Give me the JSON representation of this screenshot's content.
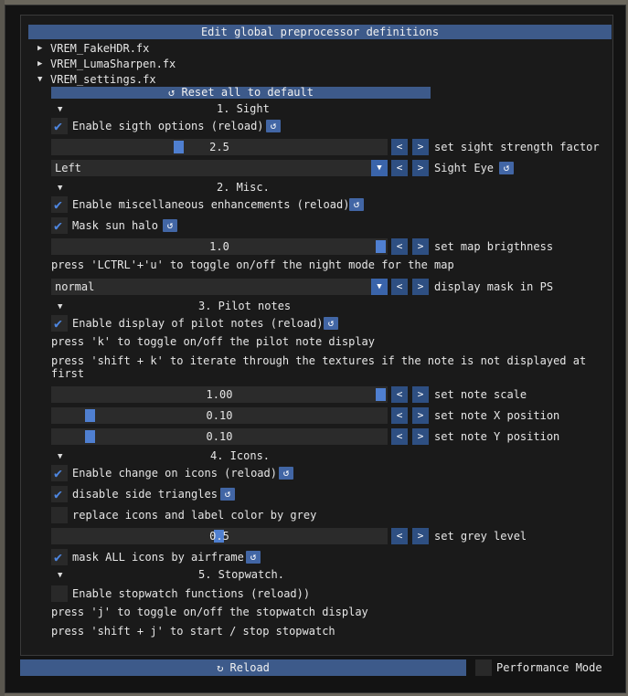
{
  "header": {
    "title": "Edit global preprocessor definitions"
  },
  "tree": [
    {
      "label": "VREM_FakeHDR.fx",
      "expanded": false
    },
    {
      "label": "VREM_LumaSharpen.fx",
      "expanded": false
    },
    {
      "label": "VREM_settings.fx",
      "expanded": true
    }
  ],
  "reset_all": {
    "icon": "↺",
    "label": "Reset all to default"
  },
  "categories": {
    "sight": "1. Sight",
    "misc": "2. Misc.",
    "pilot": "3. Pilot notes",
    "icons": "4. Icons.",
    "stopwatch": "5. Stopwatch."
  },
  "options": {
    "enable_sight": "Enable sigth options (reload)",
    "sight_strength": {
      "value": "2.5",
      "fraction": 0.38,
      "label": "set sight strength factor"
    },
    "sight_eye": {
      "value": "Left",
      "label": "Sight Eye"
    },
    "enable_misc": "Enable miscellaneous enhancements (reload)",
    "mask_sun_halo": "Mask sun halo",
    "map_brightness": {
      "value": "1.0",
      "fraction": 1.0,
      "label": "set map brigthness"
    },
    "night_mode_hint": "press 'LCTRL'+'u' to toggle on/off the night mode for the map",
    "mask_ps": {
      "value": "normal",
      "label": "display mask in PS"
    },
    "enable_pilot": "Enable display of pilot notes (reload)",
    "pilot_hint1": "press 'k' to toggle on/off the pilot note display",
    "pilot_hint2a": "press 'shift + k' to iterate through the textures if the note is not displayed at",
    "pilot_hint2b": "first",
    "note_scale": {
      "value": "1.00",
      "fraction": 1.0,
      "label": "set note scale"
    },
    "note_x": {
      "value": "0.10",
      "fraction": 0.1,
      "label": "set note X position"
    },
    "note_y": {
      "value": "0.10",
      "fraction": 0.1,
      "label": "set note Y position"
    },
    "enable_icons": "Enable change on icons (reload)",
    "disable_triangles": "disable side triangles",
    "replace_grey": "replace icons and label color by grey",
    "grey_level": {
      "value": "0.5",
      "fraction": 0.5,
      "label": "set grey level"
    },
    "mask_airframe": "mask ALL icons by airframe",
    "enable_stopwatch": "Enable stopwatch functions (reload))",
    "sw_hint1": "press 'j' to toggle on/off the stopwatch display",
    "sw_hint2": "press 'shift + j' to start / stop stopwatch"
  },
  "checked": {
    "enable_sight": true,
    "enable_misc": true,
    "mask_sun_halo": true,
    "enable_pilot": true,
    "enable_icons": true,
    "disable_triangles": true,
    "replace_grey": false,
    "mask_airframe": true,
    "enable_stopwatch": false,
    "performance_mode": false
  },
  "footer": {
    "reload_icon": "↻",
    "reload_label": "Reload",
    "performance_mode": "Performance Mode"
  },
  "icons": {
    "arrow_left": "<",
    "arrow_right": ">",
    "dropdown": "▼",
    "reset": "↺",
    "tick": "✔",
    "collapsed": "▶",
    "expanded": "▼"
  },
  "colors": {
    "accent": "#3d5a8a",
    "check": "#4d86e0",
    "frame": "#1a1a1a"
  }
}
